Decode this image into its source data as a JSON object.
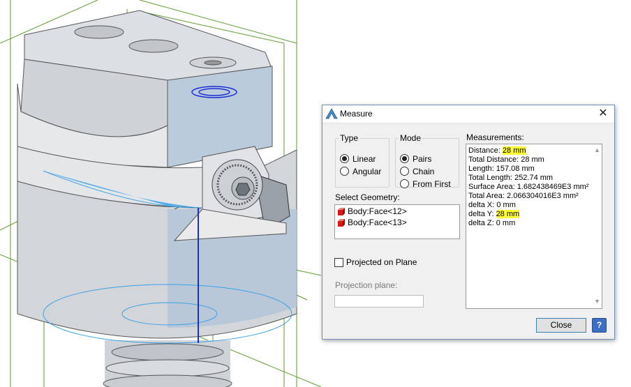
{
  "colors": {
    "viewport_bg": "#ffffff",
    "model_gray": "#d6d9dd",
    "model_blue_face": "#b9cbdb",
    "wireframe_green": "#5d9d2f",
    "selection_blue": "#3aa0e6",
    "measure_line": "#1a2fd6",
    "highlight_yellow": "#ffff33"
  },
  "dialog": {
    "title": "Measure",
    "app_icon": "measure-app-icon",
    "close_icon": "✕",
    "type": {
      "legend": "Type",
      "options": [
        "Linear",
        "Angular"
      ],
      "selected": "Linear"
    },
    "mode": {
      "legend": "Mode",
      "options": [
        "Pairs",
        "Chain",
        "From First"
      ],
      "selected": "Pairs"
    },
    "select_geometry": {
      "label": "Select Geometry:",
      "items": [
        "Body:Face<12>",
        "Body:Face<13>"
      ]
    },
    "projected_on_plane": {
      "label": "Projected on Plane",
      "checked": false
    },
    "projection_plane": {
      "label": "Projection plane:",
      "value": ""
    },
    "measurements": {
      "label": "Measurements:",
      "rows": [
        {
          "key": "Distance:",
          "value": "28 mm",
          "highlight": true
        },
        {
          "key": "Total Distance:",
          "value": "28 mm",
          "highlight": false
        },
        {
          "key": "Length:",
          "value": "157.08 mm",
          "highlight": false
        },
        {
          "key": "Total Length:",
          "value": "252.74 mm",
          "highlight": false
        },
        {
          "key": "Surface Area:",
          "value": "1.682438469E3 mm²",
          "highlight": false
        },
        {
          "key": "Total Area:",
          "value": "2.066304016E3 mm²",
          "highlight": false
        },
        {
          "key": "delta X:",
          "value": "0 mm",
          "highlight": false
        },
        {
          "key": "delta Y:",
          "value": "28 mm",
          "highlight": true
        },
        {
          "key": "delta Z:",
          "value": "0 mm",
          "highlight": false
        }
      ]
    },
    "close_button": "Close",
    "help_button": "?"
  }
}
